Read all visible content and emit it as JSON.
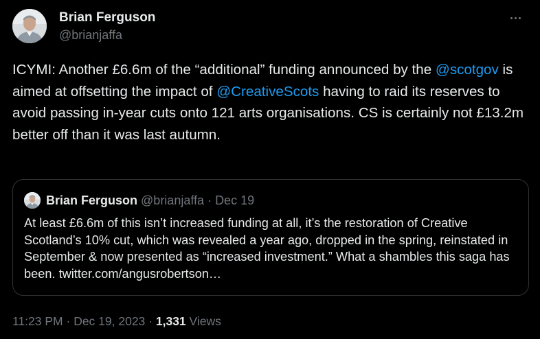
{
  "colors": {
    "background": "#000000",
    "text": "#e7e9ea",
    "secondary": "#71767b",
    "link": "#1d9bf0",
    "border": "#2f3336"
  },
  "author": {
    "name": "Brian Ferguson",
    "handle": "@brianjaffa",
    "avatar_icon": "profile-photo"
  },
  "more_icon": "more-horizontal-icon",
  "tweet": {
    "text_1": "ICYMI: Another £6.6m of the “additional” funding announced by the ",
    "mention_1": "@scotgov",
    "text_2": " is aimed at offsetting the impact of ",
    "mention_2": "@CreativeScots",
    "text_3": " having to raid its reserves to avoid passing in-year cuts onto 121 arts organisations. CS is certainly not £13.2m better off than it was last autumn."
  },
  "quote": {
    "name": "Brian Ferguson",
    "handle": "@brianjaffa",
    "separator": "·",
    "date": "Dec 19",
    "text": "At least £6.6m of this isn’t increased funding at all, it’s the restoration of Creative Scotland’s 10% cut, which was revealed a year ago, dropped in the spring, reinstated in September & now presented as “increased investment.” What a shambles this saga has been. twitter.com/angusrobertson…"
  },
  "footer": {
    "time": "11:23 PM",
    "separator": "·",
    "date": "Dec 19, 2023",
    "views_count": "1,331",
    "views_label": "Views"
  }
}
